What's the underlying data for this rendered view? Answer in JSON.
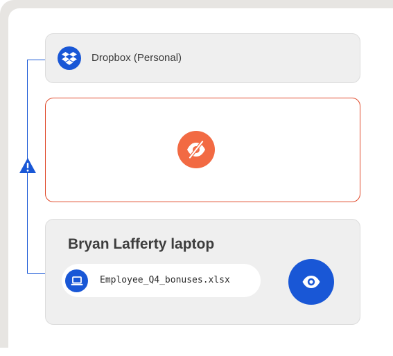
{
  "colors": {
    "accent_blue": "#1957d6",
    "alert_orange": "#f26a43",
    "alert_border": "#e0492a",
    "card_bg": "#efefef"
  },
  "connector": {
    "icon": "warning-triangle-icon"
  },
  "source_card": {
    "icon": "dropbox-logo-icon",
    "label": "Dropbox (Personal)"
  },
  "hidden_card": {
    "icon": "eye-slash-icon"
  },
  "device_card": {
    "title": "Bryan Lafferty laptop",
    "file": {
      "icon": "laptop-icon",
      "name": "Employee_Q4_bonuses.xlsx"
    },
    "view_icon": "eye-icon"
  }
}
